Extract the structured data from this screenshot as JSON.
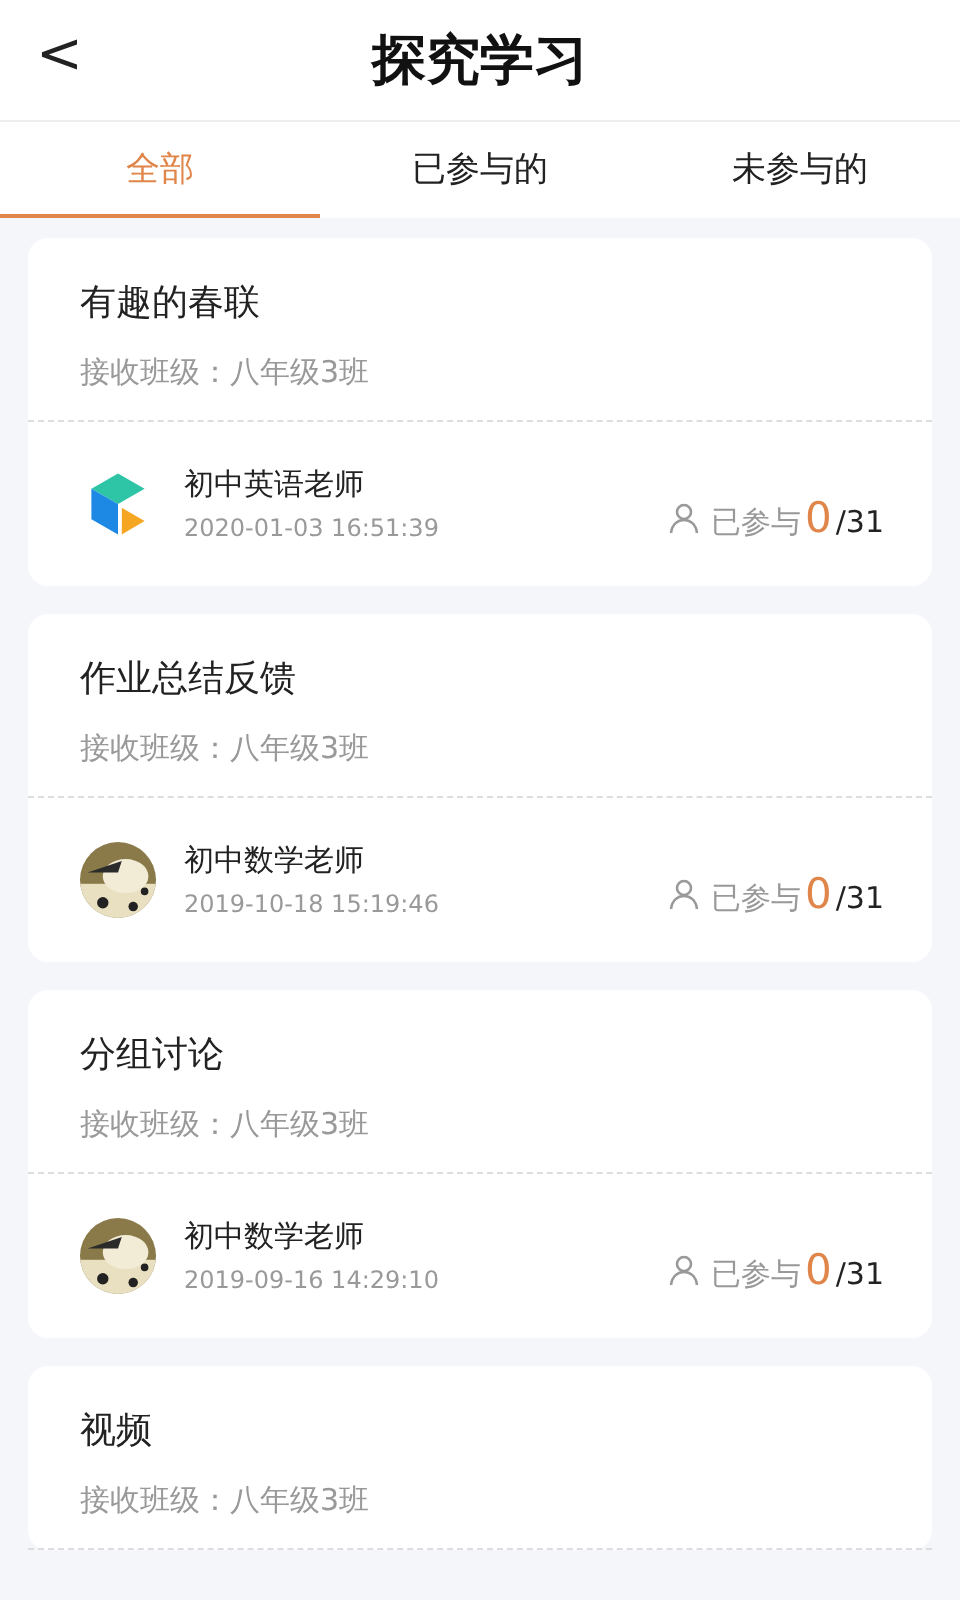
{
  "header": {
    "back": "<",
    "title": "探究学习"
  },
  "tabs": [
    {
      "label": "全部",
      "selected": true
    },
    {
      "label": "已参与的",
      "selected": false
    },
    {
      "label": "未参与的",
      "selected": false
    }
  ],
  "cards": [
    {
      "title": "有趣的春联",
      "class_label": "接收班级：八年级3班",
      "teacher": "初中英语老师",
      "avatar": {
        "kind": "logo"
      },
      "time": "2020-01-03 16:51:39",
      "joined_label": "已参与",
      "joined": "0",
      "total": "/31"
    },
    {
      "title": "作业总结反馈",
      "class_label": "接收班级：八年级3班",
      "teacher": "初中数学老师",
      "time": "2019-10-18 15:19:46",
      "joined_label": "已参与",
      "joined": "0",
      "total": "/31"
    },
    {
      "title": "分组讨论",
      "class_label": "接收班级：八年级3班",
      "teacher": "初中数学老师",
      "time": "2019-09-16 14:29:10",
      "joined_label": "已参与",
      "joined": "0",
      "total": "/31"
    },
    {
      "title": "视频",
      "class_label": "接收班级：八年级3班"
    }
  ]
}
